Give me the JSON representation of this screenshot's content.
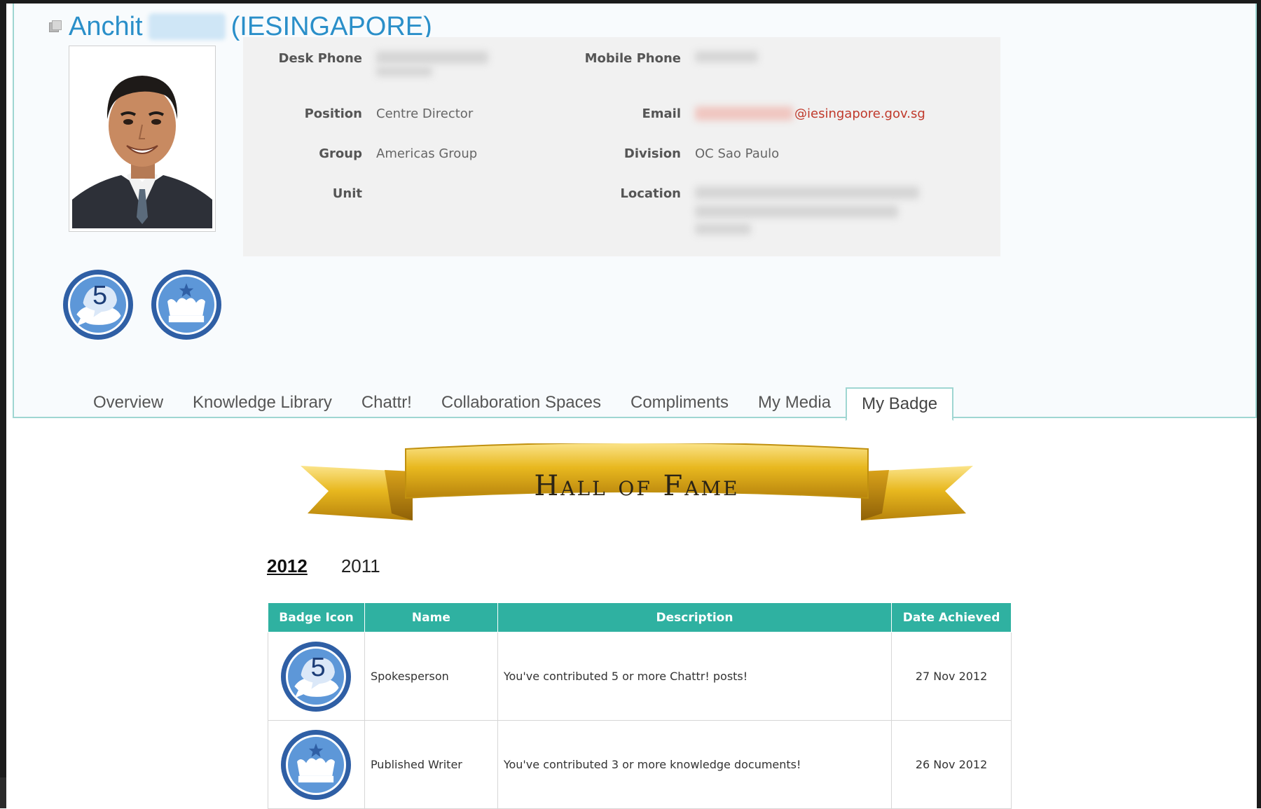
{
  "profile": {
    "first_name": "Anchit",
    "org": "(IESINGAPORE)",
    "fields": {
      "desk_phone_label": "Desk Phone",
      "mobile_phone_label": "Mobile Phone",
      "position_label": "Position",
      "position_value": "Centre Director",
      "email_label": "Email",
      "email_domain": "@iesingapore.gov.sg",
      "group_label": "Group",
      "group_value": "Americas Group",
      "division_label": "Division",
      "division_value": "OC Sao Paulo",
      "unit_label": "Unit",
      "location_label": "Location"
    },
    "badges": [
      {
        "icon": "chat-five-badge-icon",
        "number": "5"
      },
      {
        "icon": "crown-badge-icon"
      }
    ]
  },
  "tabs": [
    {
      "label": "Overview"
    },
    {
      "label": "Knowledge Library"
    },
    {
      "label": "Chattr!"
    },
    {
      "label": "Collaboration Spaces"
    },
    {
      "label": "Compliments"
    },
    {
      "label": "My Media"
    },
    {
      "label": "My Badge",
      "active": true
    }
  ],
  "hall_of_fame": {
    "banner_text": "Hall of Fame",
    "years": [
      "2012",
      "2011"
    ],
    "active_year": "2012",
    "table": {
      "headers": [
        "Badge Icon",
        "Name",
        "Description",
        "Date Achieved"
      ],
      "rows": [
        {
          "icon": "chat-five-badge-icon",
          "icon_number": "5",
          "name": "Spokesperson",
          "description": "You've contributed 5 or more Chattr! posts!",
          "date": "27 Nov 2012"
        },
        {
          "icon": "crown-badge-icon",
          "name": "Published Writer",
          "description": "You've contributed 3 or more knowledge documents!",
          "date": "26 Nov 2012"
        }
      ]
    }
  },
  "colors": {
    "name_blue": "#2a8fc9",
    "panel_border": "#9fd6d2",
    "table_header": "#2fb1a1",
    "badge_dark": "#2f5fa5",
    "badge_light": "#5d97d8",
    "ribbon_gold": "#e8b81f"
  }
}
